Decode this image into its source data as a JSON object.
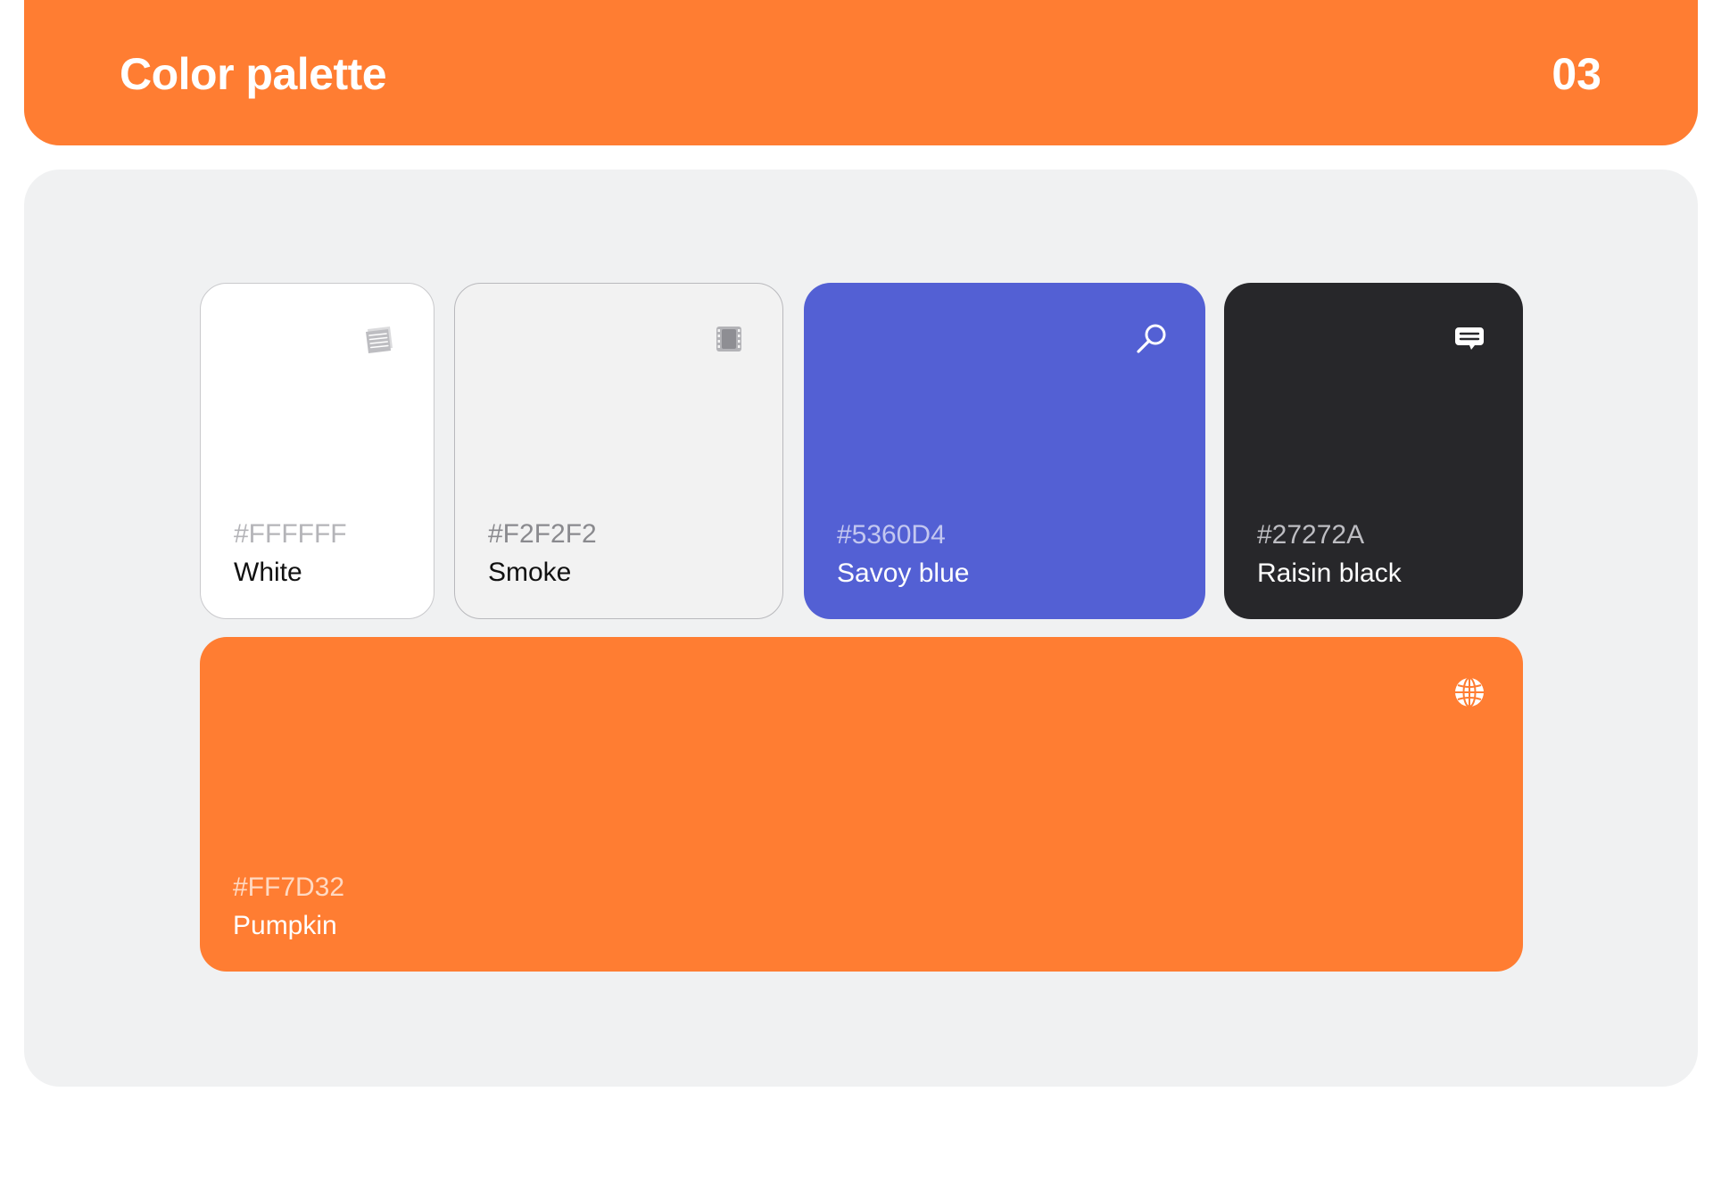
{
  "header": {
    "title": "Color palette",
    "number": "03"
  },
  "swatches": [
    {
      "hex": "#FFFFFF",
      "name": "White",
      "icon": "newspaper-icon"
    },
    {
      "hex": "#F2F2F2",
      "name": "Smoke",
      "icon": "film-icon"
    },
    {
      "hex": "#5360D4",
      "name": "Savoy blue",
      "icon": "search-icon"
    },
    {
      "hex": "#27272A",
      "name": "Raisin black",
      "icon": "chat-icon"
    },
    {
      "hex": "#FF7D32",
      "name": "Pumpkin",
      "icon": "globe-icon"
    }
  ],
  "colors": {
    "accent": "#FF7D32",
    "panel_background": "#F0F1F2"
  }
}
